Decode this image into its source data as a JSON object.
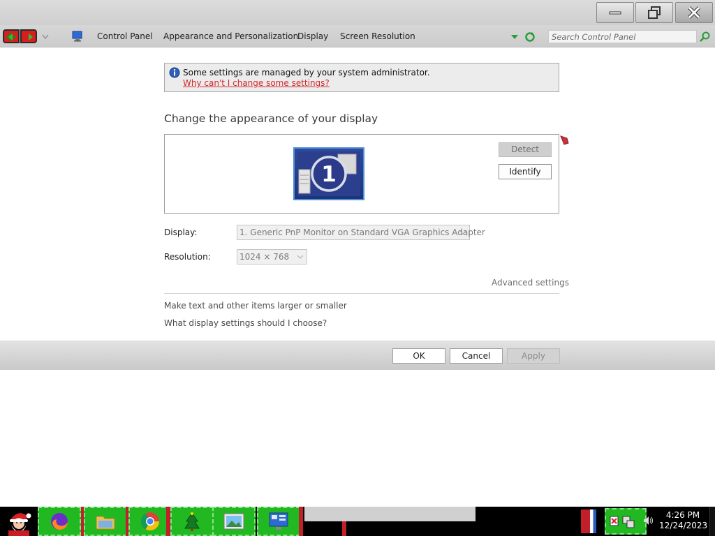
{
  "window": {
    "controls": {
      "minimize": "minimize",
      "restore": "restore",
      "close": "close"
    }
  },
  "address_bar": {
    "breadcrumbs": [
      "Control Panel",
      "Appearance and Personalization",
      "Display",
      "Screen Resolution"
    ],
    "search_placeholder": "Search Control Panel"
  },
  "info_bar": {
    "message": "Some settings are managed by your system administrator.",
    "link": "Why can't I change some settings?"
  },
  "main": {
    "heading": "Change the appearance of your display",
    "monitor_number": "1",
    "detect_label": "Detect",
    "identify_label": "Identify",
    "display_label": "Display:",
    "display_value": "1. Generic PnP Monitor on Standard VGA Graphics Adapter",
    "resolution_label": "Resolution:",
    "resolution_value": "1024 × 768",
    "advanced_settings": "Advanced settings",
    "link_larger": "Make text and other items larger or smaller",
    "link_choose": "What display settings should I choose?"
  },
  "buttons": {
    "ok": "OK",
    "cancel": "Cancel",
    "apply": "Apply"
  },
  "taskbar": {
    "apps": [
      "firefox-icon",
      "file-explorer-icon",
      "chrome-icon",
      "christmas-tree-icon",
      "photo-viewer-icon",
      "control-panel-icon"
    ],
    "time": "4:26 PM",
    "date": "12/24/2023"
  },
  "colors": {
    "link_red": "#d4272c",
    "taskbar_green": "#22b822",
    "accent_red": "#c21f2a"
  }
}
